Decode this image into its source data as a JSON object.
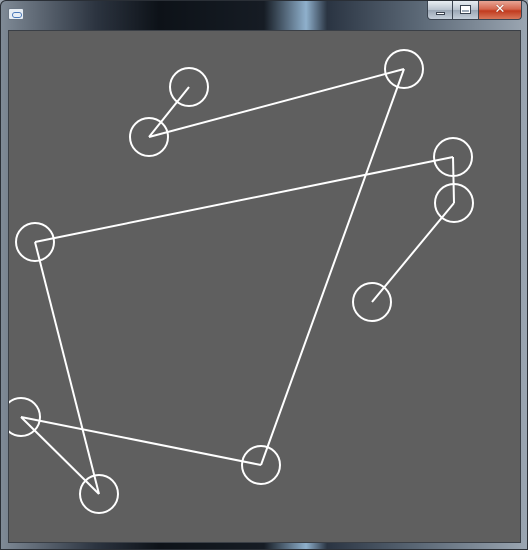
{
  "window": {
    "title": "",
    "caption_buttons": {
      "minimize_icon": "minimize-icon",
      "maximize_icon": "maximize-icon",
      "close_glyph": "✕"
    }
  },
  "canvas": {
    "background_color": "#5f5f5f",
    "stroke_color": "#ffffff"
  }
}
